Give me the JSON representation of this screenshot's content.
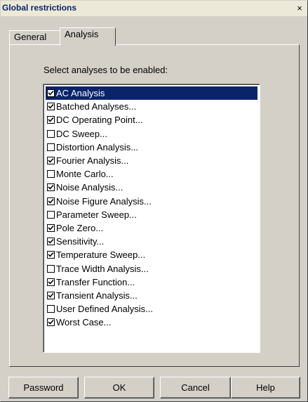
{
  "window": {
    "title": "Global restrictions",
    "close_glyph": "×"
  },
  "tabs": [
    {
      "label": "General",
      "active": false
    },
    {
      "label": "Analysis",
      "active": true
    }
  ],
  "panel": {
    "instruction": "Select analyses to be enabled:"
  },
  "analyses": [
    {
      "label": "AC Analysis",
      "checked": true,
      "selected": true
    },
    {
      "label": "Batched Analyses...",
      "checked": true,
      "selected": false
    },
    {
      "label": "DC Operating Point...",
      "checked": true,
      "selected": false
    },
    {
      "label": "DC Sweep...",
      "checked": false,
      "selected": false
    },
    {
      "label": "Distortion Analysis...",
      "checked": false,
      "selected": false
    },
    {
      "label": "Fourier Analysis...",
      "checked": true,
      "selected": false
    },
    {
      "label": "Monte Carlo...",
      "checked": false,
      "selected": false
    },
    {
      "label": "Noise Analysis...",
      "checked": true,
      "selected": false
    },
    {
      "label": "Noise Figure Analysis...",
      "checked": true,
      "selected": false
    },
    {
      "label": "Parameter Sweep...",
      "checked": false,
      "selected": false
    },
    {
      "label": "Pole Zero...",
      "checked": true,
      "selected": false
    },
    {
      "label": "Sensitivity...",
      "checked": true,
      "selected": false
    },
    {
      "label": "Temperature Sweep...",
      "checked": true,
      "selected": false
    },
    {
      "label": "Trace Width Analysis...",
      "checked": false,
      "selected": false
    },
    {
      "label": "Transfer Function...",
      "checked": true,
      "selected": false
    },
    {
      "label": "Transient Analysis...",
      "checked": true,
      "selected": false
    },
    {
      "label": "User Defined Analysis...",
      "checked": false,
      "selected": false
    },
    {
      "label": "Worst Case...",
      "checked": true,
      "selected": false
    }
  ],
  "buttons": {
    "password": "Password",
    "ok": "OK",
    "cancel": "Cancel",
    "help": "Help"
  },
  "colors": {
    "title_text": "#0a246a",
    "selection": "#0a246a",
    "face": "#d4d0c8"
  }
}
